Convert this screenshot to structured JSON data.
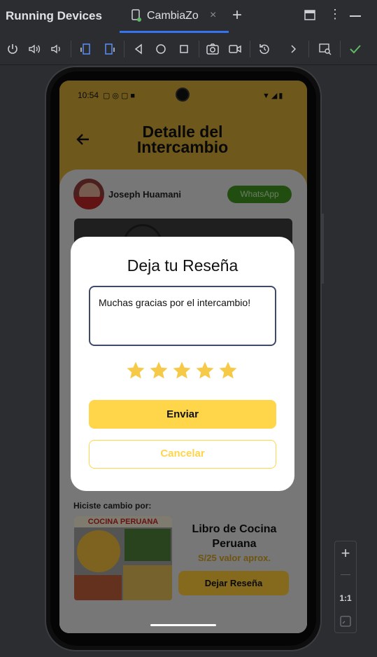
{
  "ide": {
    "panel_title": "Running Devices",
    "tab_label": "CambiaZo",
    "tab_close": "×",
    "new_tab": "+",
    "more": "⋮",
    "zoom_fit_label": "1:1",
    "zoom_in": "+",
    "zoom_out": "—",
    "accent_color": "#3574f0"
  },
  "app": {
    "status_time": "10:54",
    "title_line1": "Detalle del",
    "title_line2": "Intercambio",
    "user_name": "Joseph Huamani",
    "whatsapp_label": "WhatsApp",
    "bottom_label": "Hiciste cambio por:",
    "book_title": "Libro de Cocina Peruana",
    "book_price": "S/25 valor aprox.",
    "book_cover_text": "COCINA PERUANA",
    "review_button_label": "Dejar Reseña",
    "brand_color": "#ffd54a"
  },
  "dialog": {
    "title": "Deja tu Reseña",
    "input_value": "Muchas gracias por el intercambio!",
    "rating": 5,
    "rating_max": 5,
    "send_label": "Enviar",
    "cancel_label": "Cancelar"
  }
}
